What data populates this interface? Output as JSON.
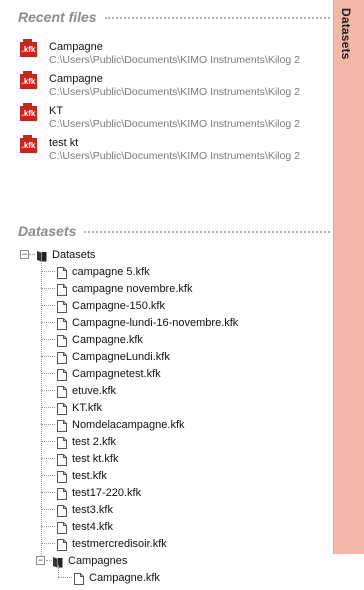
{
  "side_tab": {
    "label": "Datasets"
  },
  "recent_files": {
    "title": "Recent files",
    "items": [
      {
        "icon": "kfk-file-icon",
        "icon_label": ".kfk",
        "name": "Campagne",
        "path": "C:\\Users\\Public\\Documents\\KIMO Instruments\\Kilog 2"
      },
      {
        "icon": "kfk-file-icon",
        "icon_label": ".kfk",
        "name": "Campagne",
        "path": "C:\\Users\\Public\\Documents\\KIMO Instruments\\Kilog 2"
      },
      {
        "icon": "kfk-file-icon",
        "icon_label": ".kfk",
        "name": "KT",
        "path": "C:\\Users\\Public\\Documents\\KIMO Instruments\\Kilog 2"
      },
      {
        "icon": "kfk-file-icon",
        "icon_label": ".kfk",
        "name": "test kt",
        "path": "C:\\Users\\Public\\Documents\\KIMO Instruments\\Kilog 2"
      }
    ]
  },
  "datasets": {
    "title": "Datasets",
    "root": {
      "label": "Datasets",
      "expanded": true,
      "files": [
        "campagne 5.kfk",
        "campagne novembre.kfk",
        "Campagne-150.kfk",
        "Campagne-lundi-16-novembre.kfk",
        "Campagne.kfk",
        "CampagneLundi.kfk",
        "Campagnetest.kfk",
        "etuve.kfk",
        "KT.kfk",
        "Nomdelacampagne.kfk",
        "test 2.kfk",
        "test kt.kfk",
        "test.kfk",
        "test17-220.kfk",
        "test3.kfk",
        "test4.kfk",
        "testmercredisoir.kfk"
      ],
      "subfolder": {
        "label": "Campagnes",
        "expanded": true,
        "files": [
          "Campagne.kfk"
        ]
      }
    }
  },
  "colors": {
    "side_tab": "#f2b7a6",
    "kfk_icon": "#c8261f",
    "section_title": "#8c8c8c",
    "path_text": "#7a7a7a"
  }
}
